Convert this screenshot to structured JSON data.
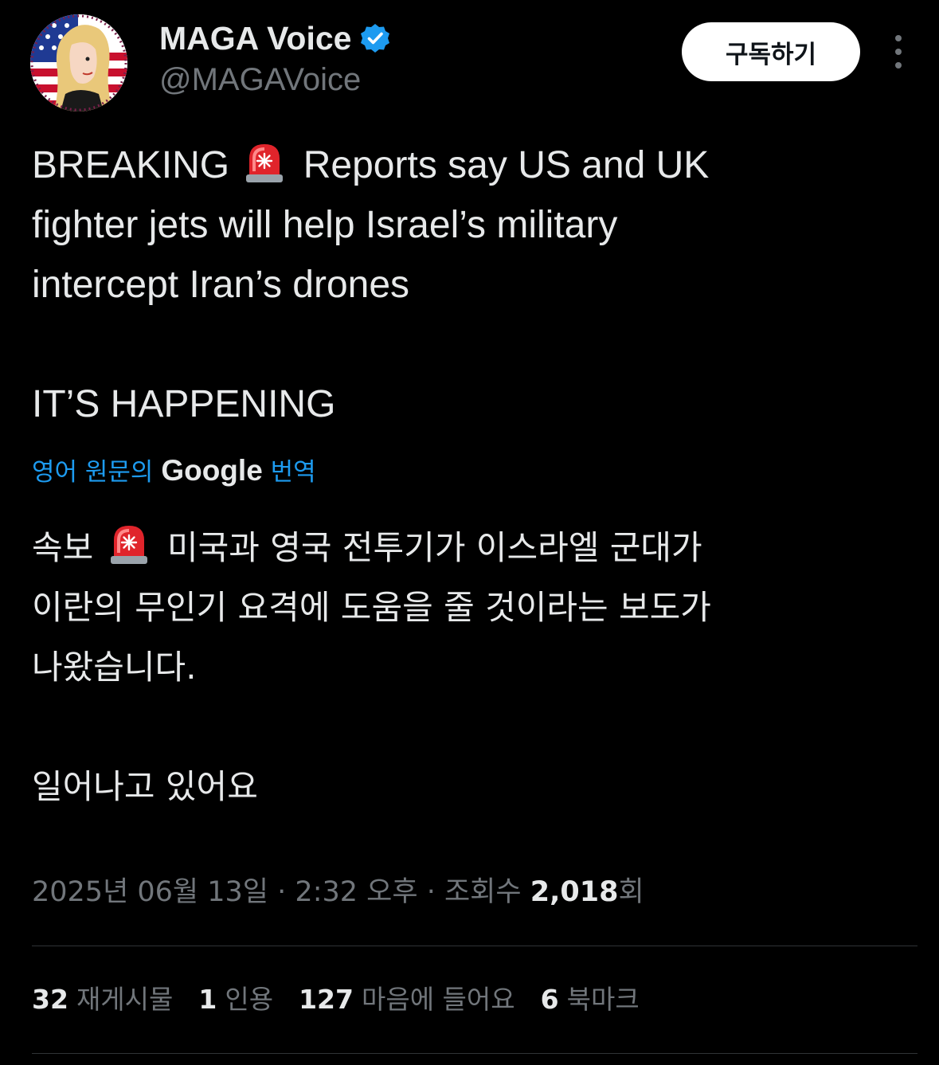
{
  "author": {
    "display_name": "MAGA Voice",
    "handle": "@MAGAVoice",
    "verified": true
  },
  "actions": {
    "subscribe_label": "구독하기"
  },
  "tweet": {
    "text_line1_before_icon": "BREAKING",
    "text_line1_after_icon": "Reports say US and UK",
    "text_line2": "fighter jets will help Israel’s military",
    "text_line3": "intercept Iran’s drones",
    "text_line4": "IT’S HAPPENING"
  },
  "translation": {
    "label_prefix": "영어 원문의",
    "label_brand": "Google",
    "label_suffix": "번역",
    "line1_before_icon": "속보",
    "line1_after_icon": "미국과 영국 전투기가 이스라엘 군대가",
    "line2": "이란의 무인기 요격에 도움을 줄 것이라는 보도가",
    "line3": "나왔습니다.",
    "line4": "일어나고 있어요"
  },
  "meta": {
    "date": "2025년 06월 13일",
    "time": "2:32 오후",
    "views_label": "조회수",
    "views_count": "2,018",
    "views_suffix": "회",
    "separator": "·"
  },
  "stats": [
    {
      "count": "32",
      "label": "재게시물"
    },
    {
      "count": "1",
      "label": "인용"
    },
    {
      "count": "127",
      "label": "마음에 들어요"
    },
    {
      "count": "6",
      "label": "북마크"
    }
  ],
  "icons": {
    "siren": "police-siren-emoji",
    "verified": "verified-badge",
    "more": "more-vertical-icon"
  },
  "colors": {
    "background": "#000000",
    "text": "#e7e9ea",
    "secondary": "#71767b",
    "link": "#1d9bf0",
    "verified": "#1d9bf0"
  }
}
